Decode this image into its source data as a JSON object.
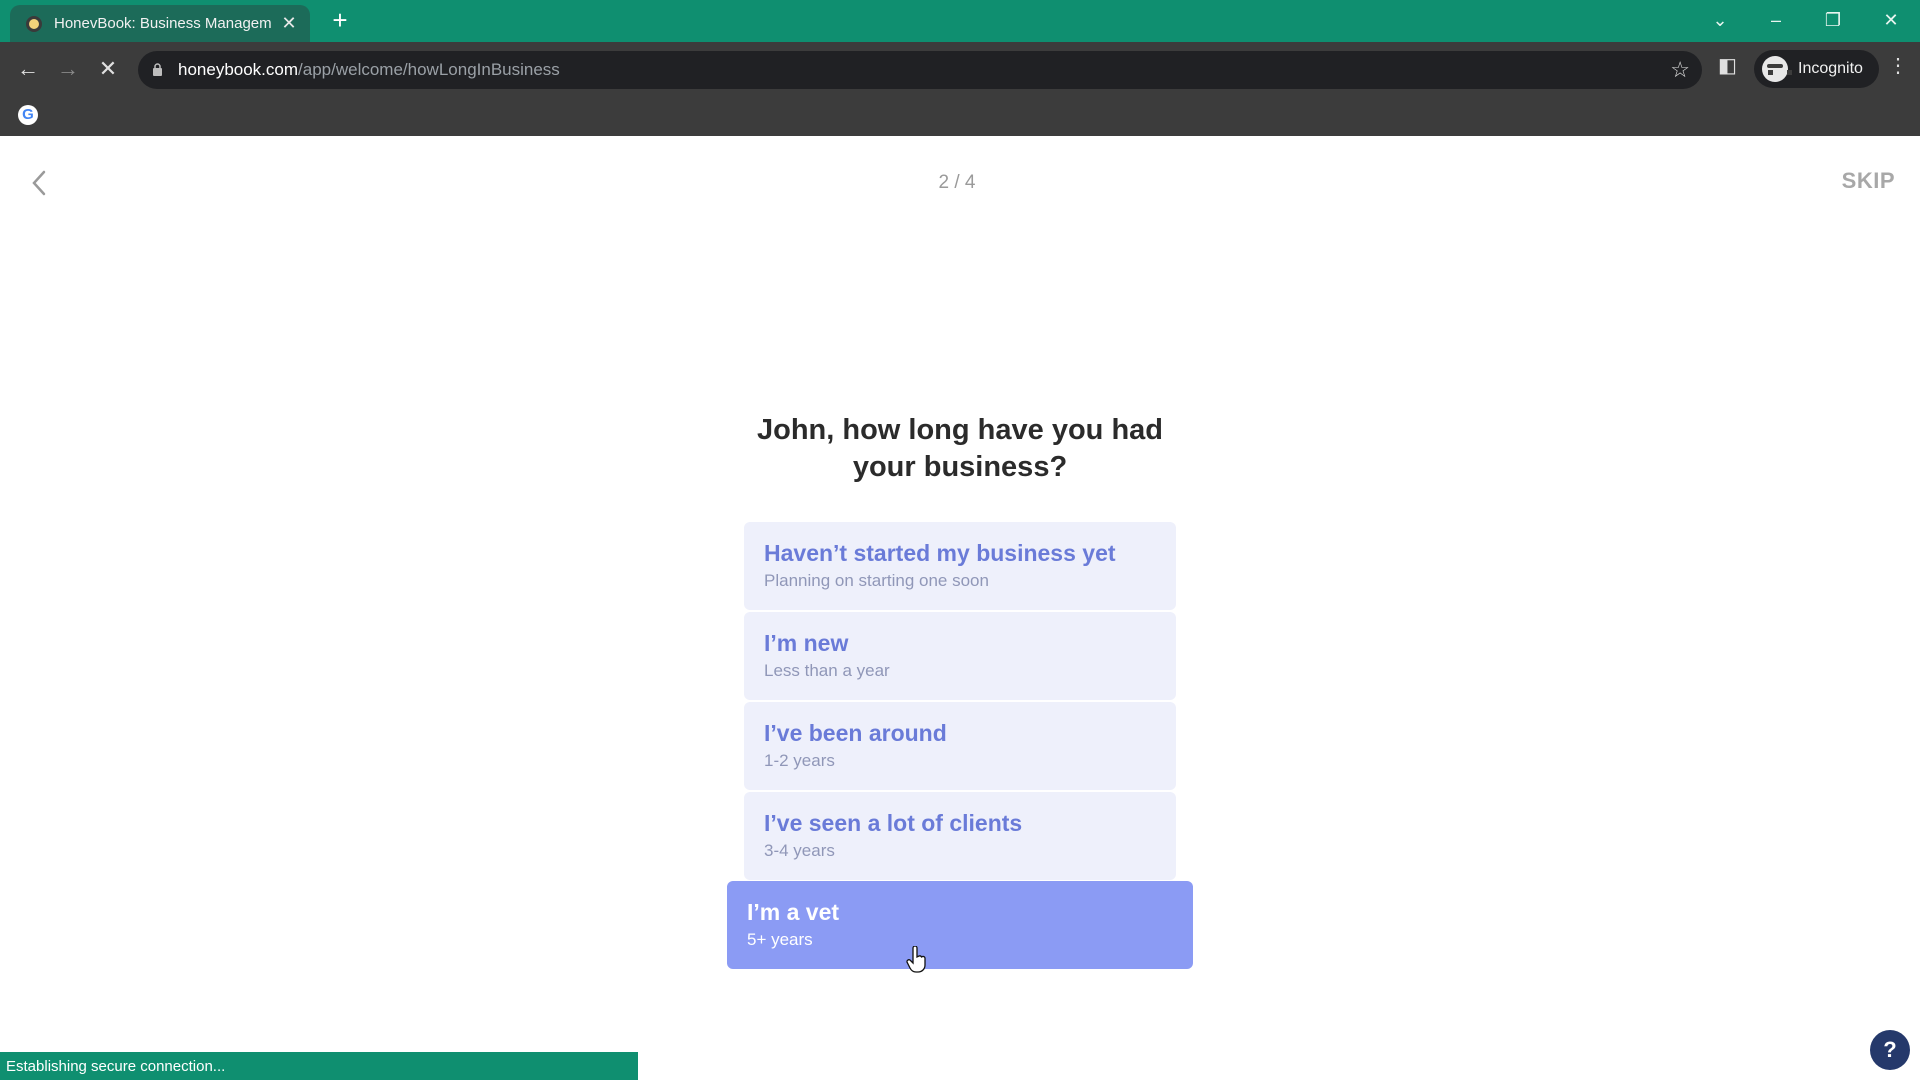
{
  "browser": {
    "tab_title": "HonevBook: Business Managem",
    "tab_close": "✕",
    "new_tab": "+",
    "url_host": "honeybook.com",
    "url_path": "/app/welcome/howLongInBusiness",
    "profile_label": "Incognito",
    "status_text": "Establishing secure connection..."
  },
  "page": {
    "progress": "2 / 4",
    "skip_label": "SKIP",
    "question": "John, how long have you had your business?",
    "options": [
      {
        "title": "Haven’t started my business yet",
        "subtitle": "Planning on starting one soon",
        "selected": false
      },
      {
        "title": "I’m new",
        "subtitle": "Less than a year",
        "selected": false
      },
      {
        "title": "I’ve been around",
        "subtitle": "1-2 years",
        "selected": false
      },
      {
        "title": "I’ve seen a lot of clients",
        "subtitle": "3-4 years",
        "selected": false
      },
      {
        "title": "I’m a vet",
        "subtitle": "5+ years",
        "selected": true
      }
    ],
    "help_label": "?"
  },
  "colors": {
    "chrome_accent": "#0f8f70",
    "option_bg": "#eef0fb",
    "option_text": "#6a7bd8",
    "option_selected_bg": "#8b9bf4"
  }
}
